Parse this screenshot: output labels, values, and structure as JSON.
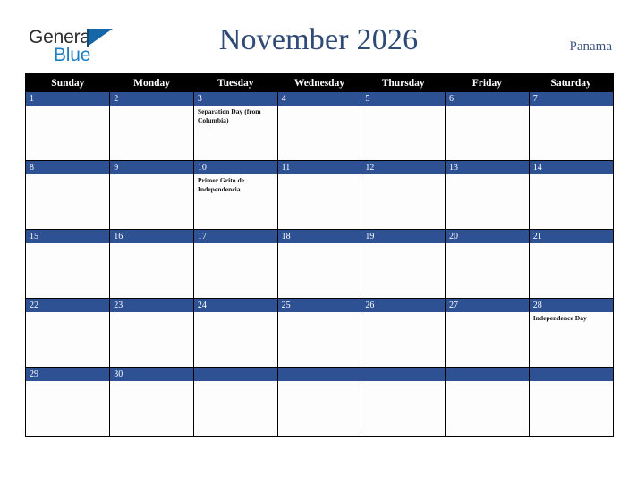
{
  "brand": {
    "word_general": "General",
    "word_blue": "Blue",
    "logo_color": "#1567a8"
  },
  "header": {
    "title": "November 2026",
    "region": "Panama",
    "title_color": "#2e4a75"
  },
  "theme": {
    "banner_blue": "#2e5193",
    "header_row_bg": "#000000",
    "grid_border": "#000000",
    "cell_bg": "#fdfdfd"
  },
  "calendar": {
    "weekday_headers": [
      "Sunday",
      "Monday",
      "Tuesday",
      "Wednesday",
      "Thursday",
      "Friday",
      "Saturday"
    ],
    "weeks": [
      [
        {
          "date": "1",
          "event": ""
        },
        {
          "date": "2",
          "event": ""
        },
        {
          "date": "3",
          "event": "Separation Day (from Columbia)"
        },
        {
          "date": "4",
          "event": ""
        },
        {
          "date": "5",
          "event": ""
        },
        {
          "date": "6",
          "event": ""
        },
        {
          "date": "7",
          "event": ""
        }
      ],
      [
        {
          "date": "8",
          "event": ""
        },
        {
          "date": "9",
          "event": ""
        },
        {
          "date": "10",
          "event": "Primer Grito de Independencia"
        },
        {
          "date": "11",
          "event": ""
        },
        {
          "date": "12",
          "event": ""
        },
        {
          "date": "13",
          "event": ""
        },
        {
          "date": "14",
          "event": ""
        }
      ],
      [
        {
          "date": "15",
          "event": ""
        },
        {
          "date": "16",
          "event": ""
        },
        {
          "date": "17",
          "event": ""
        },
        {
          "date": "18",
          "event": ""
        },
        {
          "date": "19",
          "event": ""
        },
        {
          "date": "20",
          "event": ""
        },
        {
          "date": "21",
          "event": ""
        }
      ],
      [
        {
          "date": "22",
          "event": ""
        },
        {
          "date": "23",
          "event": ""
        },
        {
          "date": "24",
          "event": ""
        },
        {
          "date": "25",
          "event": ""
        },
        {
          "date": "26",
          "event": ""
        },
        {
          "date": "27",
          "event": ""
        },
        {
          "date": "28",
          "event": "Independence Day"
        }
      ],
      [
        {
          "date": "29",
          "event": ""
        },
        {
          "date": "30",
          "event": ""
        },
        {
          "date": "",
          "event": ""
        },
        {
          "date": "",
          "event": ""
        },
        {
          "date": "",
          "event": ""
        },
        {
          "date": "",
          "event": ""
        },
        {
          "date": "",
          "event": ""
        }
      ]
    ]
  }
}
